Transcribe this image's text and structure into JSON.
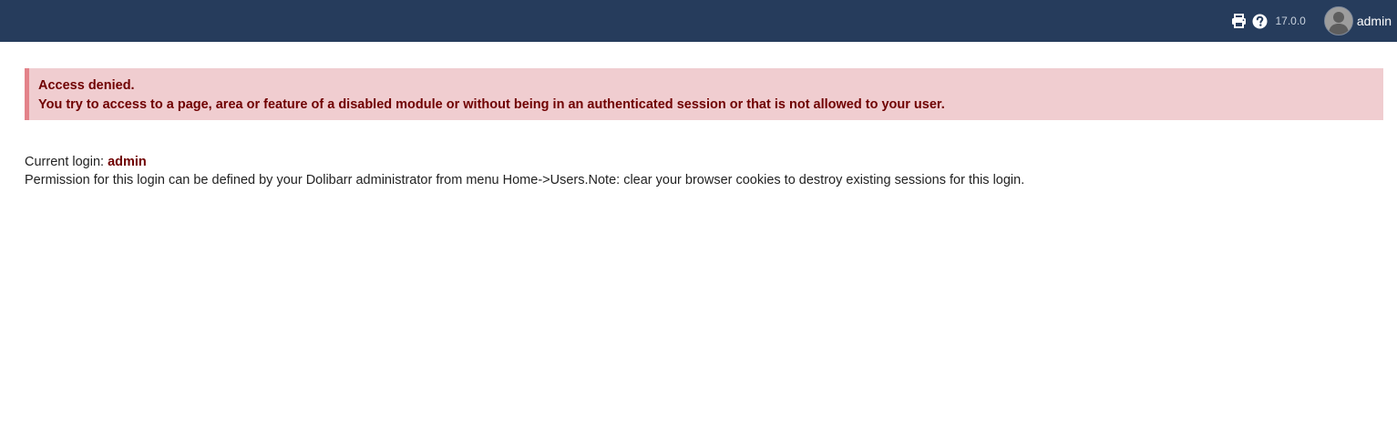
{
  "topbar": {
    "background": "#263c5c",
    "icons": [
      "print-icon",
      "help-icon"
    ],
    "version": "17.0.0",
    "user": {
      "name": "admin"
    }
  },
  "alert": {
    "title": "Access denied.",
    "message": "You try to access to a page, area or feature of a disabled module or without being in an authenticated session or that is not allowed to your user.",
    "background": "#f0cdd0",
    "border_color": "#e3838a",
    "text_color": "#6f0000"
  },
  "info": {
    "current_login_label": "Current login:",
    "current_login_value": "admin",
    "permission_text": "Permission for this login can be defined by your Dolibarr administrator from menu Home->Users.Note: clear your browser cookies to destroy existing sessions for this login."
  }
}
